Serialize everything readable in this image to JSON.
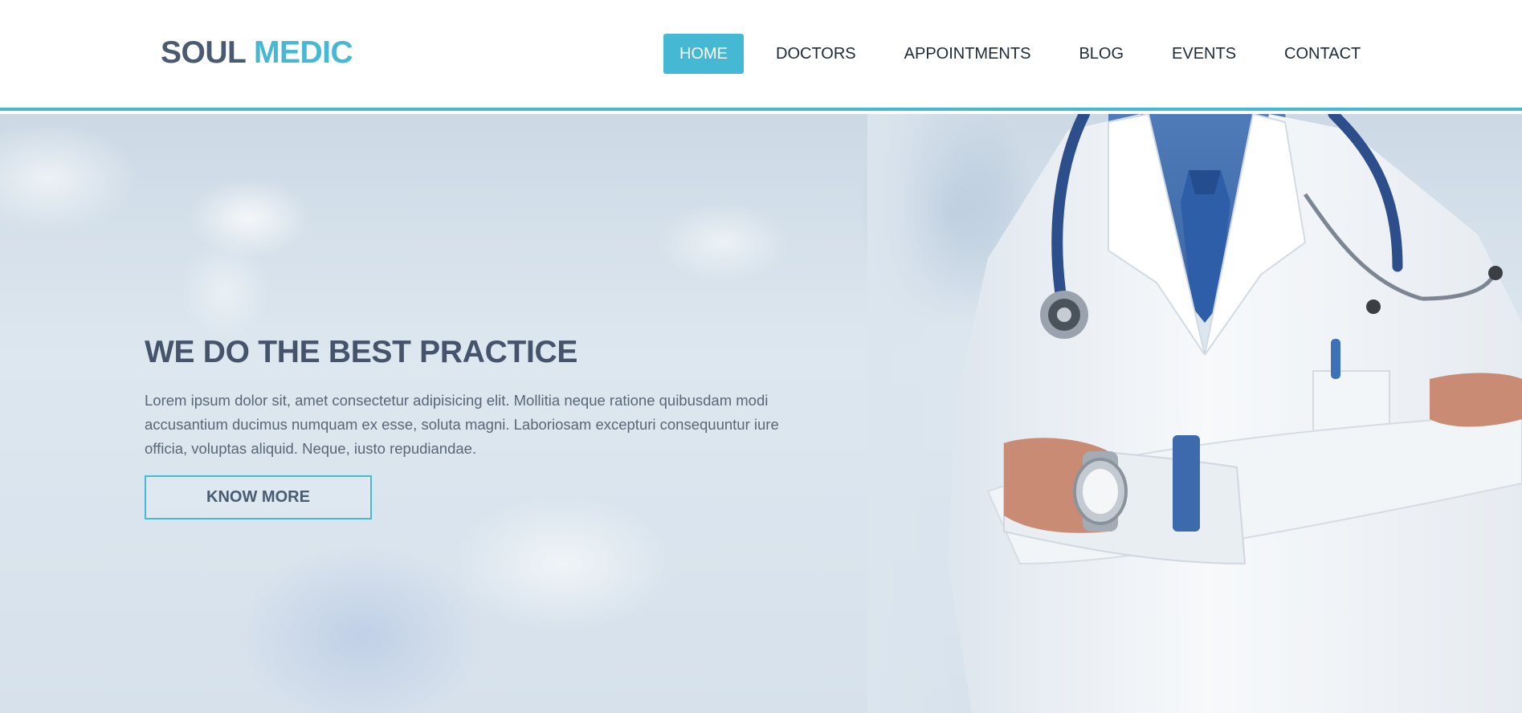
{
  "brand": {
    "part1": "SOUL",
    "part2": "MEDIC"
  },
  "nav": {
    "items": [
      {
        "label": "HOME",
        "active": true
      },
      {
        "label": "DOCTORS",
        "active": false
      },
      {
        "label": "APPOINTMENTS",
        "active": false
      },
      {
        "label": "BLOG",
        "active": false
      },
      {
        "label": "EVENTS",
        "active": false
      },
      {
        "label": "CONTACT",
        "active": false
      }
    ]
  },
  "hero": {
    "title": "WE DO THE BEST PRACTICE",
    "text": "Lorem ipsum dolor sit, amet consectetur adipisicing elit. Mollitia neque ratione quibusdam modi accusantium ducimus numquam ex esse, soluta magni. Laboriosam excepturi consequuntur iure officia, voluptas aliquid. Neque, iusto repudiandae.",
    "button_label": "KNOW MORE",
    "image": "doctor-photo"
  },
  "colors": {
    "accent": "#45b8d3",
    "dark_text": "#4a5a70",
    "nav_text": "#1f2a36"
  }
}
